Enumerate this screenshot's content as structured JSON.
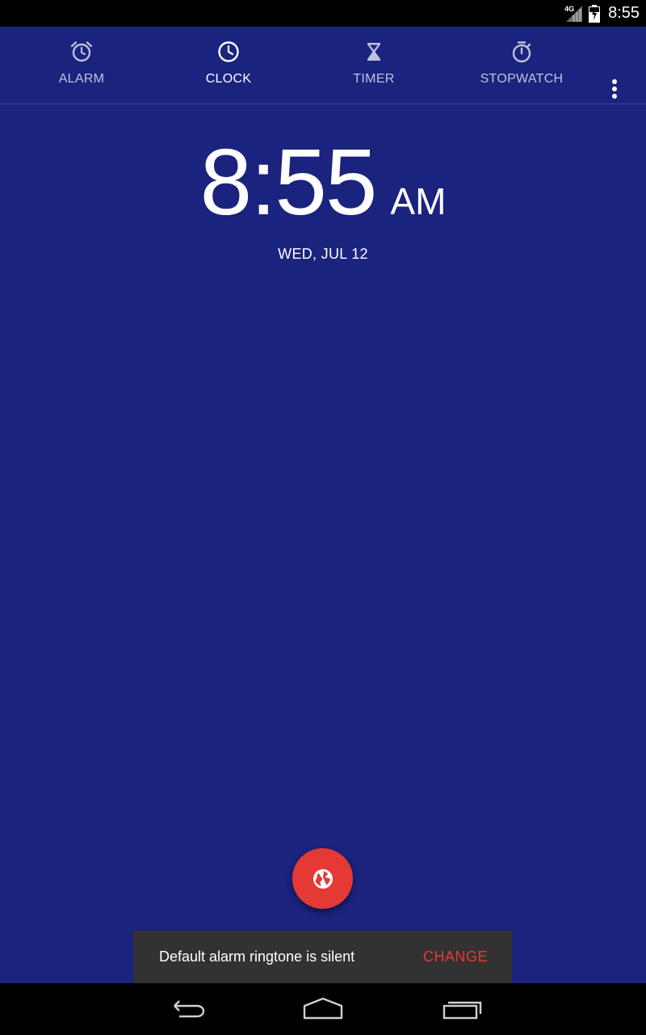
{
  "status_bar": {
    "network": "4G",
    "time": "8:55",
    "icons": [
      "signal-icon",
      "battery-icon"
    ]
  },
  "tabs": [
    {
      "label": "ALARM",
      "icon": "alarm-icon",
      "active": false
    },
    {
      "label": "CLOCK",
      "icon": "clock-icon",
      "active": true
    },
    {
      "label": "TIMER",
      "icon": "hourglass-icon",
      "active": false
    },
    {
      "label": "STOPWATCH",
      "icon": "stopwatch-icon",
      "active": false
    }
  ],
  "overflow_menu": {
    "icon": "more-vert-icon"
  },
  "clock": {
    "time": "8:55",
    "ampm": "AM",
    "date": "WED, JUL 12"
  },
  "fab": {
    "icon": "globe-icon"
  },
  "snackbar": {
    "message": "Default alarm ringtone is silent",
    "action": "CHANGE"
  },
  "nav_bar": {
    "buttons": [
      "back-icon",
      "home-icon",
      "recents-icon"
    ]
  },
  "colors": {
    "background": "#1A237E",
    "accent": "#E53935",
    "snackbar": "#323232"
  }
}
